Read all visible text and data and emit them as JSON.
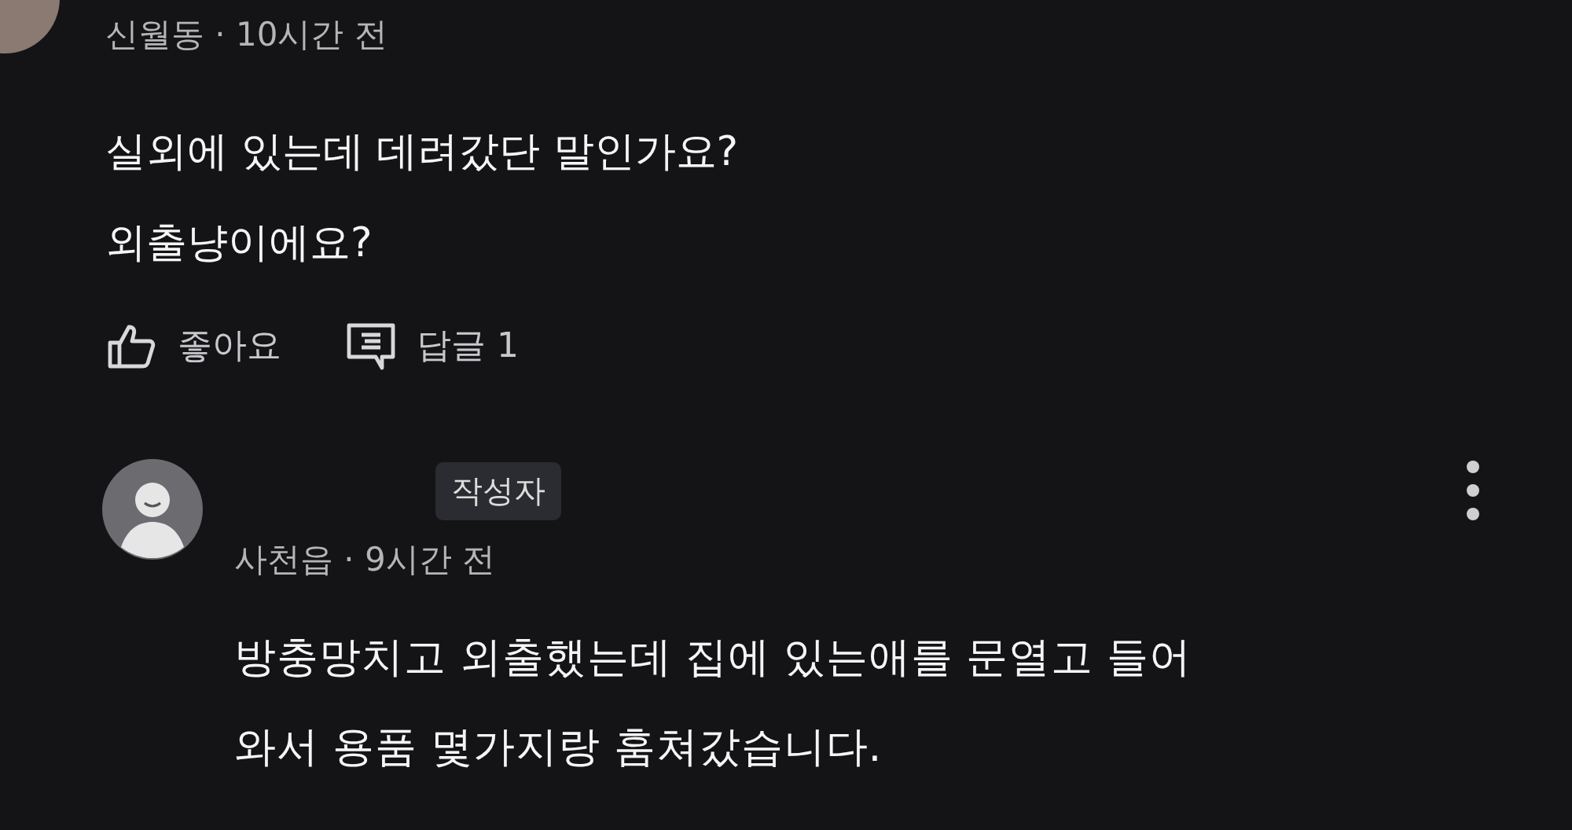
{
  "comment": {
    "meta": "신월동 · 10시간 전",
    "lines": [
      "실외에 있는데 데려갔단 말인가요?",
      "외출냥이에요?"
    ],
    "like_label": "좋아요",
    "reply_label": "답글 1"
  },
  "reply": {
    "badge": "작성자",
    "meta": "사천읍 · 9시간 전",
    "lines": [
      "방충망치고 외출했는데 집에 있는애를 문열고 들어",
      "와서 용품 몇가지랑 훔쳐갔습니다."
    ]
  }
}
